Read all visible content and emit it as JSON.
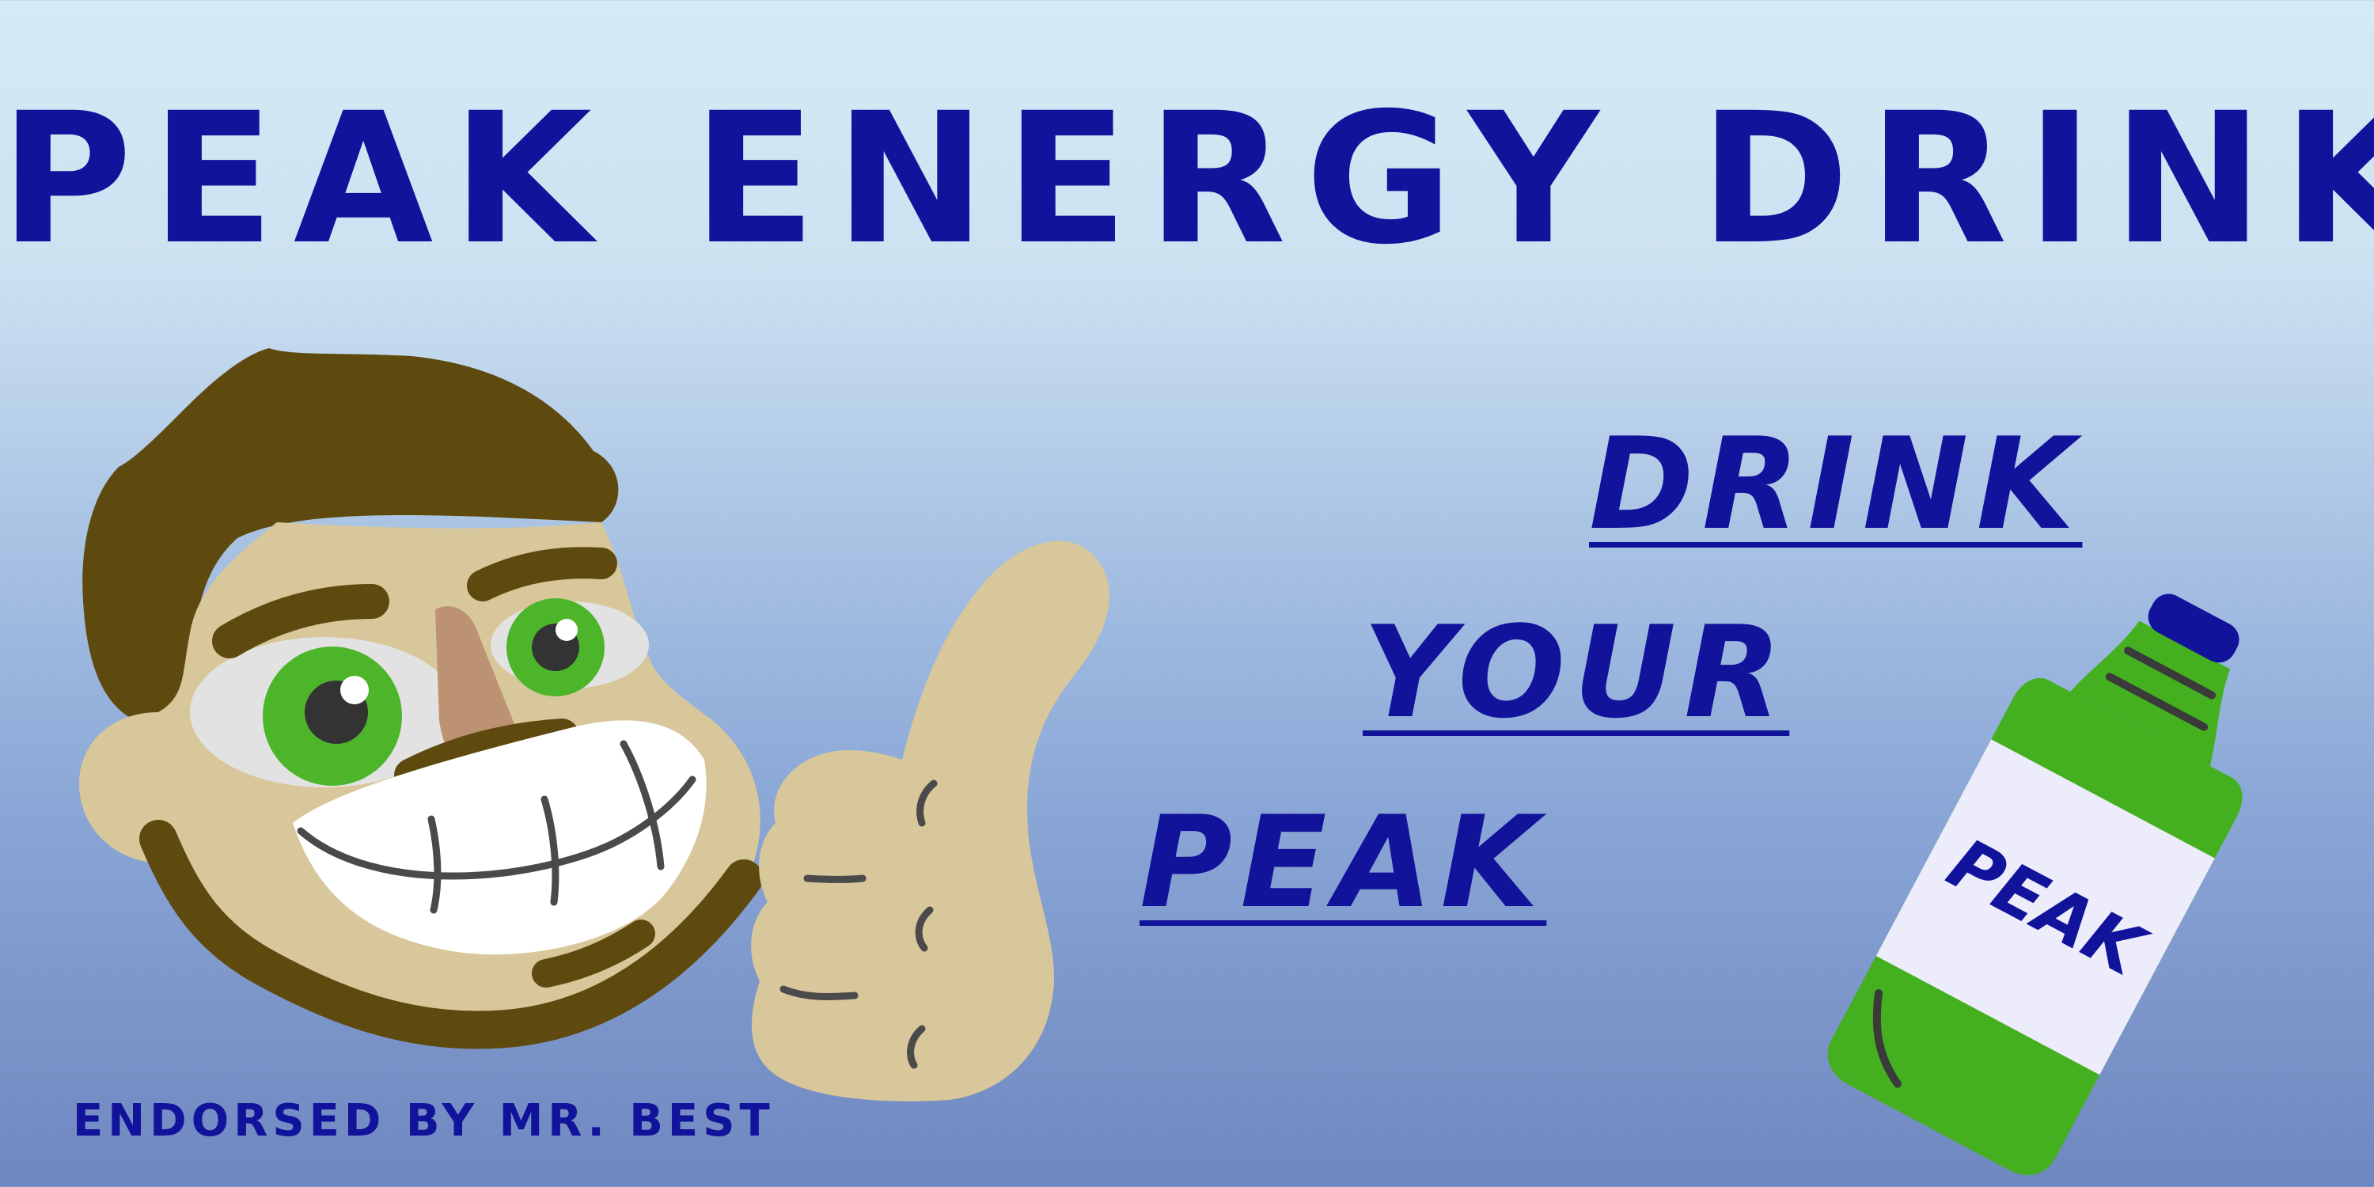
{
  "headline": "PEAK ENERGY DRINK",
  "slogan": [
    "DRINK",
    "YOUR",
    "PEAK"
  ],
  "bottle_label": "PEAK",
  "endorsement": "ENDORSED BY MR. BEST",
  "colors": {
    "brand_blue": "#11139b",
    "bottle_green": "#44b01f",
    "skin": "#d8c79a",
    "hair": "#5e4a0e"
  }
}
